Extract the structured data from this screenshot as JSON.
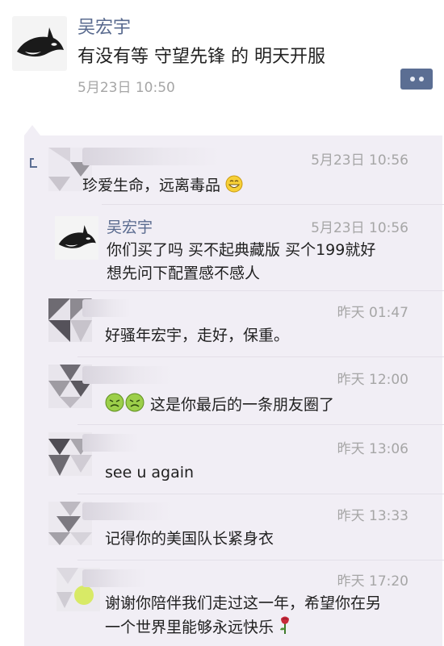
{
  "post": {
    "author": "吴宏宇",
    "text": "有没有等 守望先锋 的 明天开服",
    "time": "5月23日 10:50",
    "more_icon": "more-dots-icon",
    "avatar_icon": "orca-avatar-icon"
  },
  "comments": [
    {
      "name": "",
      "time": "5月23日 10:56",
      "text": "珍爱生命，远离毒品",
      "suffix_emoji": "grin-emoji"
    },
    {
      "name": "吴宏宇",
      "time": "5月23日 10:56",
      "text_lines": [
        "你们买了吗 买不起典藏版 买个199就好",
        "想先问下配置感不感人"
      ]
    },
    {
      "name": "",
      "time": "昨天 01:47",
      "text": "好骚年宏宇，走好，保重。"
    },
    {
      "name": "",
      "time": "昨天 12:00",
      "text": "这是你最后的一条朋友圈了",
      "prefix_emoji": "sick-face-emoji"
    },
    {
      "name": "",
      "time": "昨天 13:06",
      "text": "see u again"
    },
    {
      "name": "",
      "time": "昨天 13:33",
      "text": "记得你的美国队长紧身衣"
    },
    {
      "name": "",
      "time": "昨天 17:20",
      "text_lines": [
        "谢谢你陪伴我们走过这一年，希望你在另",
        "一个世界里能够永远快乐"
      ],
      "suffix_emoji": "rose-emoji"
    }
  ],
  "colors": {
    "name": "#5a6b8f",
    "time": "#a6a6a6",
    "panel": "#f1eef5",
    "button": "#5b6e93"
  }
}
